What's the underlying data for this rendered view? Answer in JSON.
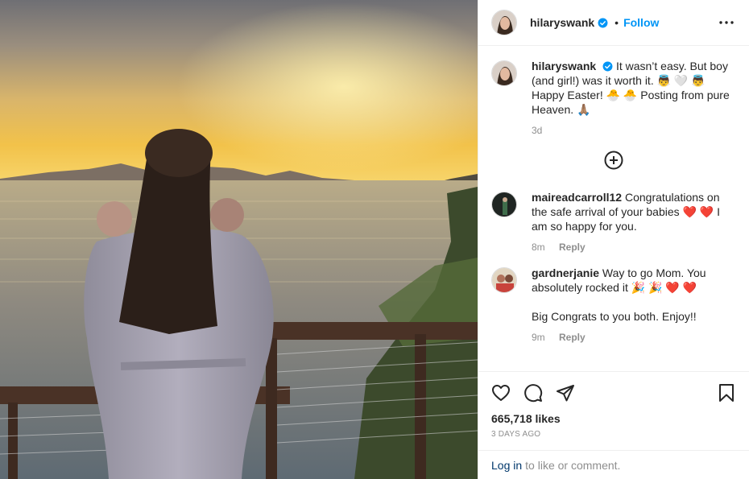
{
  "post": {
    "username": "hilaryswank",
    "dot": "•",
    "follow_label": "Follow",
    "icons": [
      "verified-badge-icon",
      "more-options-icon"
    ]
  },
  "caption": {
    "username": "hilaryswank",
    "text": "It wasn’t easy. But boy (and girl!) was it worth it. 👼 🤍 👼 Happy Easter! 🐣 🐣 Posting from pure Heaven. 🙏🏽",
    "time": "3d"
  },
  "load_more_icon": "plus-circle-icon",
  "comments": [
    {
      "username": "maireadcarroll12",
      "text": "Congratulations on the safe arrival of your babies ❤️ ❤️ I am so happy for you.",
      "time": "8m",
      "reply_label": "Reply"
    },
    {
      "username": "gardnerjanie",
      "text": "Way to go Mom. You absolutely rocked it 🎉 🎉 ❤️ ❤️",
      "text2": "Big Congrats to you both. Enjoy!!",
      "time": "9m",
      "reply_label": "Reply"
    }
  ],
  "actions": {
    "icons": [
      "heart-icon",
      "comment-icon",
      "share-icon",
      "bookmark-icon"
    ],
    "likes": "665,718 likes",
    "date": "3 DAYS AGO"
  },
  "login": {
    "link": "Log in",
    "rest": "to like or comment."
  },
  "colors": {
    "accent": "#0095f6",
    "link": "#00376b",
    "secondary_text": "#8e8e8e",
    "border": "#efefef"
  }
}
